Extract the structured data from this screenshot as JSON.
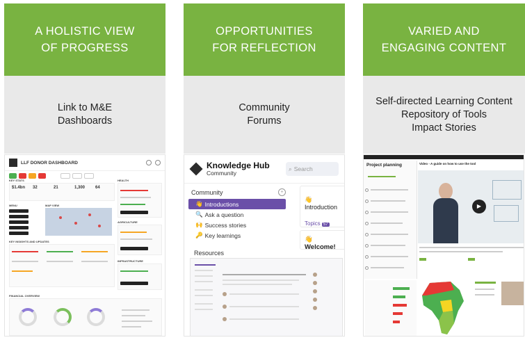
{
  "columns": [
    {
      "banner_line1": "A HOLISTIC VIEW",
      "banner_line2": "OF PROGRESS",
      "sub_line1": "Link to M&E",
      "sub_line2": "Dashboards",
      "sub_line3": ""
    },
    {
      "banner_line1": "OPPORTUNITIES",
      "banner_line2": "FOR REFLECTION",
      "sub_line1": "Community",
      "sub_line2": "Forums",
      "sub_line3": ""
    },
    {
      "banner_line1": "VARIED AND",
      "banner_line2": "ENGAGING CONTENT",
      "sub_line1": "Self-directed Learning Content",
      "sub_line2": "Repository of Tools",
      "sub_line3": "Impact Stories"
    }
  ],
  "dashboard": {
    "title": "LLF DONOR DASHBOARD",
    "sections": [
      "KEY STATS",
      "HEALTH",
      "MENU",
      "MAP VIEW",
      "AGRICULTURE",
      "KEY INSIGHTS AND UPDATES",
      "INFRASTRUCTURE",
      "FINANCIAL OVERVIEW"
    ],
    "stats": [
      "$1.4bn",
      "32",
      "21",
      "1,300",
      "64"
    ]
  },
  "hub": {
    "name": "Knowledge Hub",
    "sub": "Community",
    "search_placeholder": "Search",
    "community_heading": "Community",
    "items": [
      "Introductions",
      "Ask a question",
      "Success stories",
      "Key learnings"
    ],
    "resources_heading": "Resources",
    "card_intro": "Introduction",
    "topics_label": "Topics",
    "topics_count": "57",
    "welcome": "Welcome!"
  },
  "learning": {
    "side_title": "Project planning",
    "video_title": "Video - A guide on how to use the tool"
  },
  "colors": {
    "banner_green": "#79b341",
    "sub_grey": "#e9e9e9",
    "hub_purple": "#6a4fa8"
  }
}
